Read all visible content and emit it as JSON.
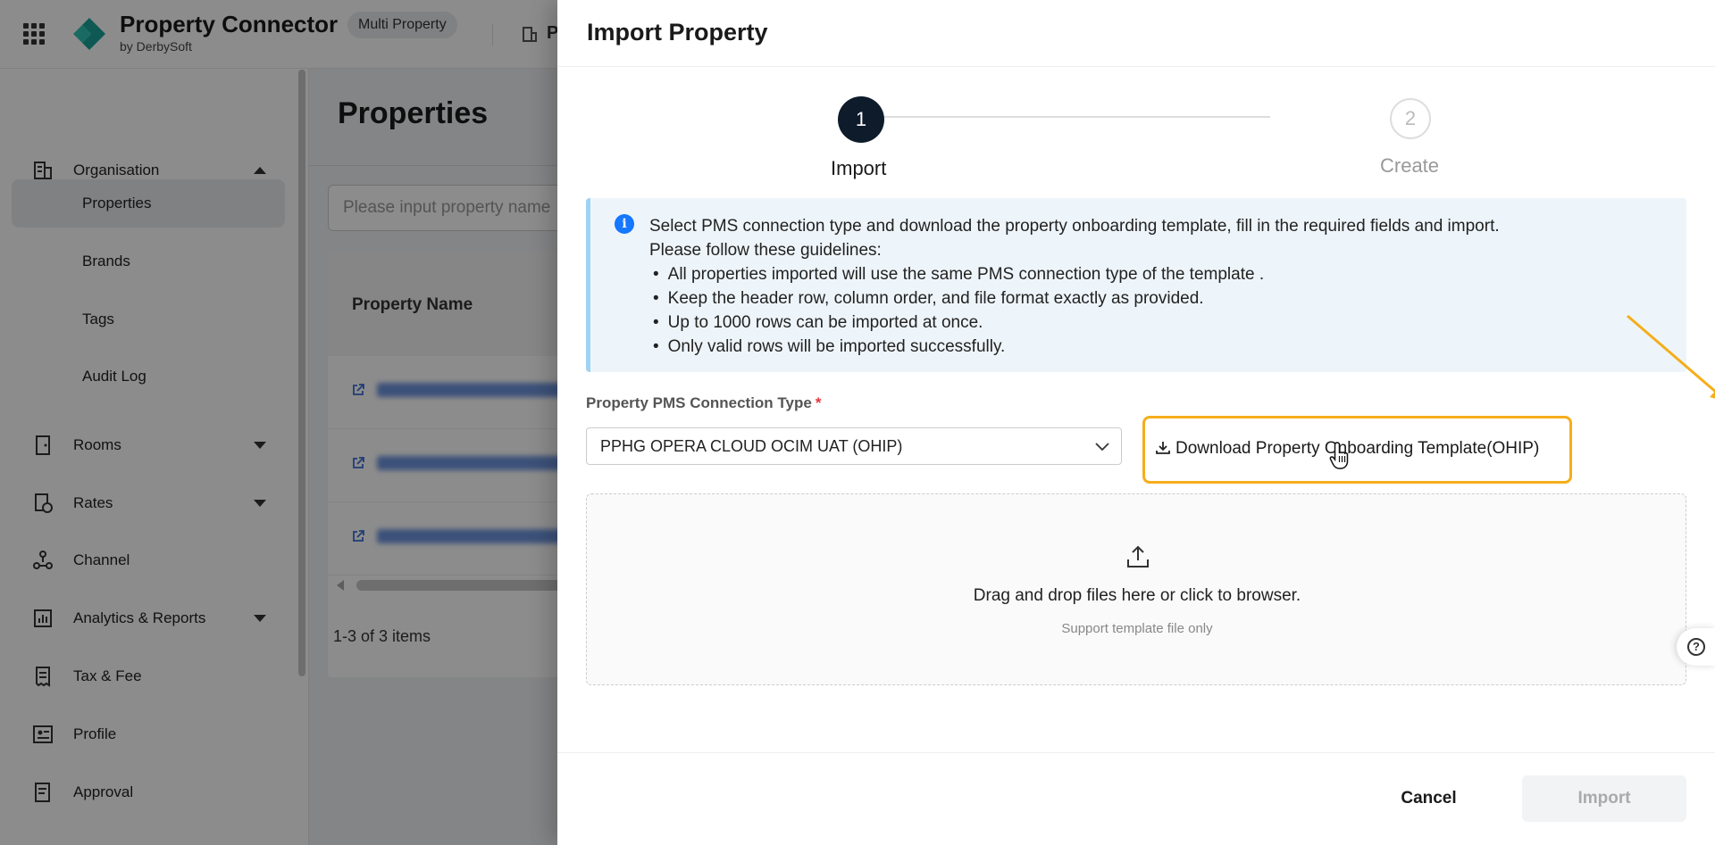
{
  "topbar": {
    "brand_name": "Property Connector",
    "brand_sub": "by DerbySoft",
    "mode_pill": "Multi Property",
    "peek_text": "P"
  },
  "sidebar": {
    "items": [
      {
        "label": "Organisation",
        "icon": "building-icon",
        "expanded": true
      },
      {
        "label": "Properties",
        "sub": true,
        "active": true
      },
      {
        "label": "Brands",
        "sub": true
      },
      {
        "label": "Tags",
        "sub": true
      },
      {
        "label": "Audit Log",
        "sub": true
      },
      {
        "label": "Rooms",
        "icon": "door-icon",
        "expandable": true
      },
      {
        "label": "Rates",
        "icon": "rate-doc-icon",
        "expandable": true
      },
      {
        "label": "Channel",
        "icon": "network-icon"
      },
      {
        "label": "Analytics & Reports",
        "icon": "chart-icon",
        "expandable": true
      },
      {
        "label": "Tax & Fee",
        "icon": "receipt-icon"
      },
      {
        "label": "Profile",
        "icon": "profile-card-icon"
      },
      {
        "label": "Approval",
        "icon": "approval-icon"
      }
    ]
  },
  "main": {
    "title": "Properties",
    "search_placeholder": "Please input property name",
    "table_header": "Property Name",
    "pager": "1-3 of 3 items"
  },
  "drawer": {
    "title": "Import Property",
    "steps": [
      {
        "number": "1",
        "label": "Import",
        "state": "active"
      },
      {
        "number": "2",
        "label": "Create",
        "state": "inactive"
      }
    ],
    "info": {
      "line1": "Select PMS connection type and download the property onboarding template, fill in the required fields and import.",
      "line2": "Please follow these guidelines:",
      "bullets": [
        "All properties imported will use the same PMS connection type of the template .",
        "Keep the header row, column order, and file format exactly as provided.",
        "Up to 1000 rows can be imported at once.",
        "Only valid rows will be imported successfully."
      ]
    },
    "field_label": "Property PMS Connection Type",
    "required_mark": "*",
    "select_value": "PPHG OPERA CLOUD OCIM UAT (OHIP)",
    "download_label": "Download Property Onboarding Template(OHIP)",
    "drop_text": "Drag and drop files here or click to browser.",
    "drop_hint": "Support template file only",
    "help_label": "?",
    "cancel_label": "Cancel",
    "import_label": "Import"
  },
  "colors": {
    "highlight": "#f5ae1b",
    "step_active": "#0d1b2a",
    "info_accent": "#1677ff",
    "logo_teal": "#1aa39a"
  }
}
